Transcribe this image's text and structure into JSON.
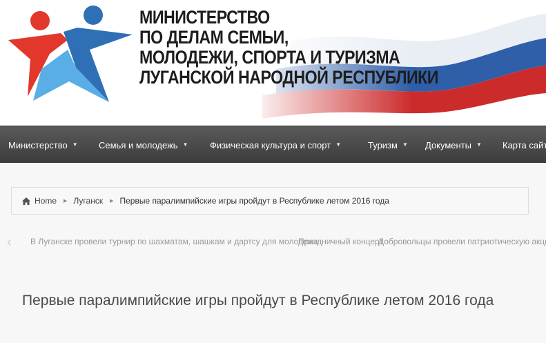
{
  "header": {
    "title_lines": [
      "МИНИСТЕРСТВО",
      "ПО ДЕЛАМ СЕМЬИ,",
      "МОЛОДЕЖИ, СПОРТА И ТУРИЗМА",
      "ЛУГАНСКОЙ НАРОДНОЙ РЕСПУБЛИКИ"
    ],
    "logo_icon": "star-figures-logo",
    "flag_colors": [
      "#ffffff",
      "#2f5fa8",
      "#cc2b2b"
    ]
  },
  "nav": {
    "items": [
      {
        "label": "Министерство"
      },
      {
        "label": "Семья и молодежь"
      },
      {
        "label": "Физическая культура и спорт"
      },
      {
        "label": "Туризм"
      },
      {
        "label": "Документы"
      },
      {
        "label": "Карта сайта"
      }
    ]
  },
  "breadcrumb": {
    "home": "Home",
    "section": "Луганск",
    "current": "Первые паралимпийские игры пройдут в Республике летом 2016 года"
  },
  "slider": {
    "slides": [
      "В Луганске провели турнир по шахматам, шашкам и дартсу для молодежи",
      "Праздничный концерт",
      "Добровольцы провели патриотическую акцию"
    ]
  },
  "article": {
    "title": "Первые паралимпийские игры пройдут в Республике летом 2016 года"
  },
  "colors": {
    "logo_red": "#e2372b",
    "logo_blue": "#2f6fb5",
    "logo_light_blue": "#4fa3e0",
    "nav_bg": "#474747"
  }
}
